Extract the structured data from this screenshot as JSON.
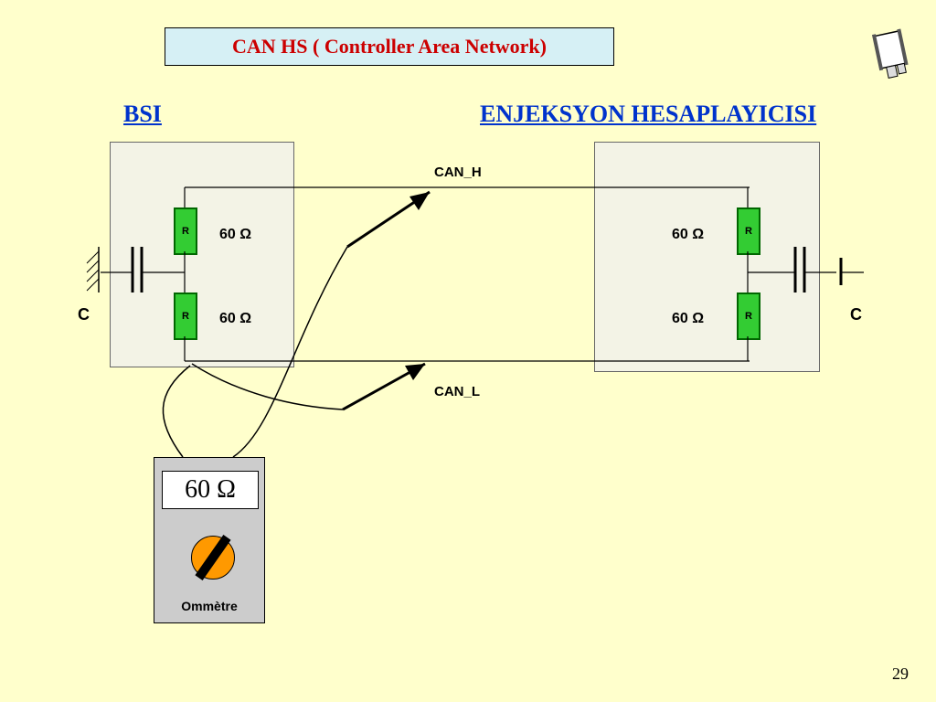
{
  "title": "CAN HS ( Controller Area Network)",
  "labels": {
    "bsi": "BSI",
    "enjeksyon": "ENJEKSYON HESAPLAYICISI",
    "can_h": "CAN_H",
    "can_l": "CAN_L",
    "c_left": "C",
    "c_right": "C"
  },
  "resistors": {
    "left_top": "60 Ω",
    "left_bottom": "60 Ω",
    "right_top": "60 Ω",
    "right_bottom": "60 Ω",
    "r_sym": "R"
  },
  "meter": {
    "reading": "60 Ω",
    "caption": "Ommètre"
  },
  "slide_number": "29"
}
